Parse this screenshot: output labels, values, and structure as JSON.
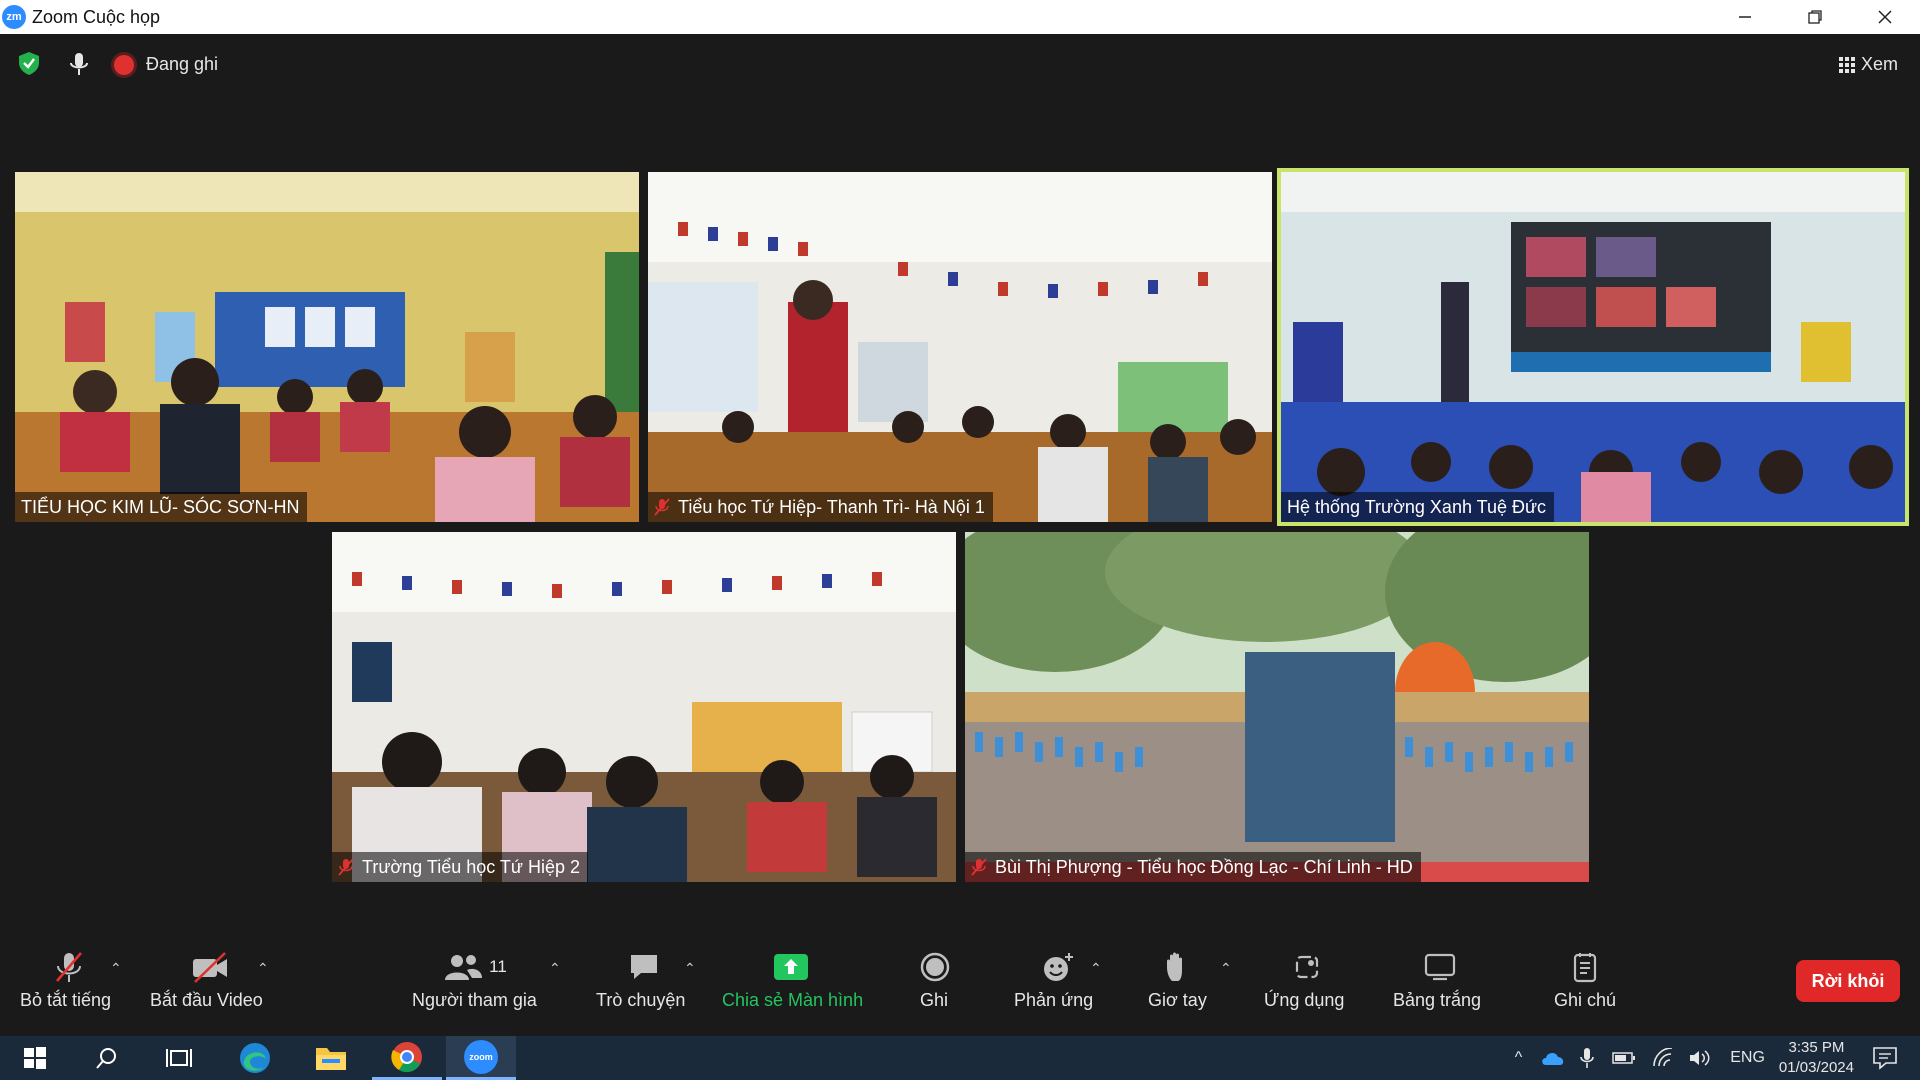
{
  "window": {
    "title": "Zoom Cuộc họp",
    "logo_text": "zm"
  },
  "topbar": {
    "recording_label": "Đang ghi",
    "view_label": "Xem"
  },
  "participants": [
    {
      "name": "TIỂU HỌC KIM LŨ- SÓC SƠN-HN",
      "muted": false,
      "active_speaker": false
    },
    {
      "name": "Tiểu học Tứ Hiệp- Thanh Trì- Hà Nội 1",
      "muted": true,
      "active_speaker": false
    },
    {
      "name": "Hệ thống Trường Xanh Tuệ Đức",
      "muted": false,
      "active_speaker": true
    },
    {
      "name": "Trường Tiểu học Tứ Hiệp 2",
      "muted": true,
      "active_speaker": false
    },
    {
      "name": "Bùi Thị Phượng - Tiểu học Đồng Lạc - Chí Linh - HD",
      "muted": true,
      "active_speaker": false
    }
  ],
  "toolbar": {
    "mute_label": "Bỏ tắt tiếng",
    "video_label": "Bắt đầu Video",
    "participants_label": "Người tham gia",
    "participants_count": "11",
    "chat_label": "Trò chuyện",
    "share_label": "Chia sẻ Màn hình",
    "record_label": "Ghi",
    "reactions_label": "Phản ứng",
    "raise_hand_label": "Giơ tay",
    "apps_label": "Ứng dụng",
    "whiteboard_label": "Bảng trắng",
    "notes_label": "Ghi chú",
    "leave_label": "Rời khỏi"
  },
  "taskbar": {
    "language": "ENG",
    "time": "3:35 PM",
    "date": "01/03/2024",
    "zoom_icon_text": "zoom"
  },
  "colors": {
    "active_border": "#c8e46a",
    "share_green": "#22c55e",
    "leave_red": "#e02828",
    "taskbar": "#1b2a3a"
  }
}
